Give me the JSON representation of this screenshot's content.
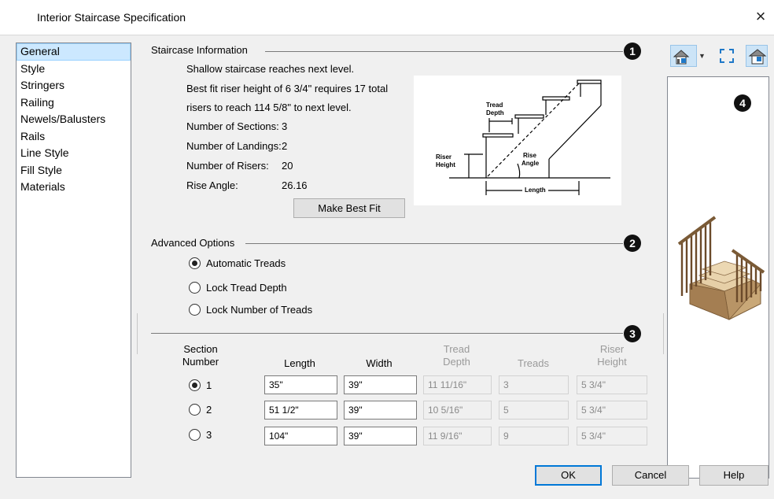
{
  "window": {
    "title": "Interior Staircase Specification",
    "close_glyph": "×"
  },
  "sidebar": {
    "items": [
      {
        "label": "General",
        "selected": true
      },
      {
        "label": "Style"
      },
      {
        "label": "Stringers"
      },
      {
        "label": "Railing"
      },
      {
        "label": "Newels/Balusters"
      },
      {
        "label": "Rails"
      },
      {
        "label": "Line Style"
      },
      {
        "label": "Fill Style"
      },
      {
        "label": "Materials"
      }
    ]
  },
  "staircase_info": {
    "heading": "Staircase Information",
    "badge": "1",
    "line1": "Shallow staircase reaches next level.",
    "line2": "Best fit riser height of 6 3/4\" requires 17 total",
    "line3": "risers to reach 114 5/8\" to next level.",
    "sections_label": "Number of Sections:",
    "sections_value": "3",
    "landings_label": "Number of Landings:",
    "landings_value": "2",
    "risers_label": "Number of Risers:",
    "risers_value": "20",
    "rise_angle_label": "Rise Angle:",
    "rise_angle_value": "26.16",
    "make_best_fit": "Make Best Fit"
  },
  "diagram": {
    "tread": "Tread",
    "depth": "Depth",
    "riser": "Riser",
    "height": "Height",
    "rise": "Rise",
    "angle": "Angle",
    "length": "Length"
  },
  "advanced": {
    "heading": "Advanced Options",
    "badge": "2",
    "options": [
      {
        "label": "Automatic Treads",
        "checked": true
      },
      {
        "label": "Lock Tread Depth",
        "checked": false
      },
      {
        "label": "Lock Number of Treads",
        "checked": false
      }
    ]
  },
  "sections": {
    "badge": "3",
    "headers": {
      "section_1": "Section",
      "section_2": "Number",
      "length": "Length",
      "width": "Width",
      "tread_1": "Tread",
      "tread_2": "Depth",
      "treads": "Treads",
      "riser_1": "Riser",
      "riser_2": "Height"
    },
    "rows": [
      {
        "num": "1",
        "selected": true,
        "length": "35\"",
        "width": "39\"",
        "tread_depth": "11 11/16\"",
        "treads": "3",
        "riser_height": "5 3/4\""
      },
      {
        "num": "2",
        "selected": false,
        "length": "51 1/2\"",
        "width": "39\"",
        "tread_depth": "10 5/16\"",
        "treads": "5",
        "riser_height": "5 3/4\""
      },
      {
        "num": "3",
        "selected": false,
        "length": "104\"",
        "width": "39\"",
        "tread_depth": "11 9/16\"",
        "treads": "9",
        "riser_height": "5 3/4\""
      }
    ]
  },
  "preview": {
    "badge": "4",
    "icons": [
      "camera-view-icon",
      "fit-view-icon",
      "floor-plan-view-icon"
    ]
  },
  "footer": {
    "ok": "OK",
    "cancel": "Cancel",
    "help": "Help"
  }
}
